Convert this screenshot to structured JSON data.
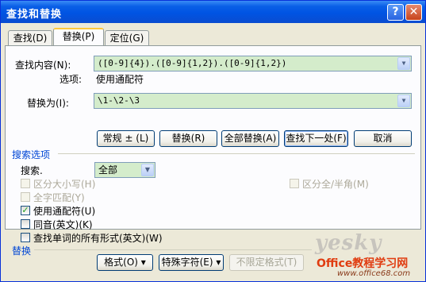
{
  "window": {
    "title": "查找和替换",
    "help": "?",
    "close": "✕"
  },
  "tabs": [
    {
      "label": "查找(D)",
      "active": false
    },
    {
      "label": "替换(P)",
      "active": true
    },
    {
      "label": "定位(G)",
      "active": false
    }
  ],
  "find": {
    "label": "查找内容(N):",
    "value": "([0-9]{4}).([0-9]{1,2}).([0-9]{1,2})",
    "options_label": "选项:",
    "options_value": "使用通配符"
  },
  "replace": {
    "label": "替换为(I):",
    "value": "\\1-\\2-\\3"
  },
  "buttons": {
    "less": "常规 ± (L)",
    "replace": "替换(R)",
    "replace_all": "全部替换(A)",
    "find_next": "查找下一处(F)",
    "cancel": "取消"
  },
  "search_options": {
    "title": "搜索选项",
    "search_label": "搜索.",
    "search_value": "全部",
    "match_case": "区分大小写(H)",
    "whole_word": "全字匹配(Y)",
    "wildcards": "使用通配符(U)",
    "sounds_like": "同音(英文)(K)",
    "all_forms": "查找单词的所有形式(英文)(W)",
    "match_width": "区分全/半角(M)",
    "wildcards_checked": true
  },
  "replace_section": {
    "title": "替换",
    "format": "格式(O) ▾",
    "special": "特殊字符(E) ▾",
    "no_format": "不限定格式(T)"
  },
  "watermark": {
    "yesky": "yesky",
    "office": "Office教程学习网",
    "url": "www.office68.com"
  }
}
